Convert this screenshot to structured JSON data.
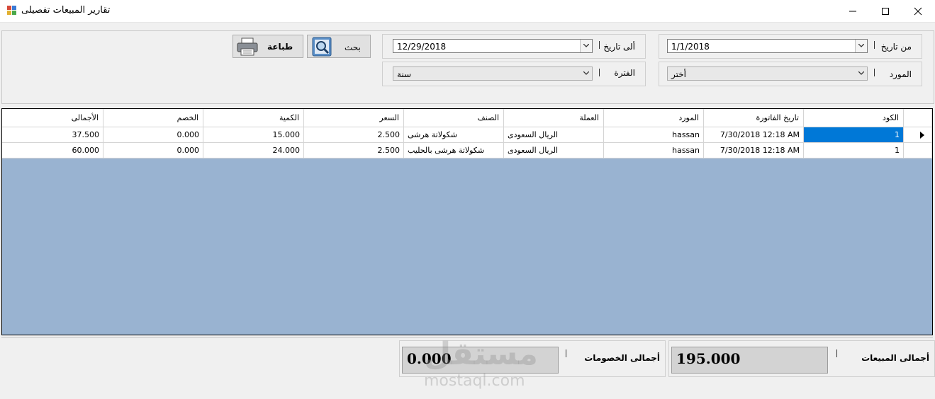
{
  "window": {
    "title": "تقارير المبيعات تفصيلى",
    "minimize_glyph": "—",
    "maximize_glyph": "☐",
    "close_glyph": "✕"
  },
  "filters": {
    "from_date_label": "من تاريخ",
    "from_date_value": "1/1/2018",
    "to_date_label": "ألى تاريخ",
    "to_date_value": "12/29/2018",
    "supplier_label": "المورد",
    "supplier_value": "أختر",
    "period_label": "الفترة",
    "period_value": "سنة"
  },
  "toolbar": {
    "search_label": "بحث",
    "print_label": "طباعة"
  },
  "grid": {
    "columns": [
      "الكود",
      "تاريخ الفاتورة",
      "المورد",
      "العملة",
      "الصنف",
      "السعر",
      "الكمية",
      "الخصم",
      "الأجمالى"
    ],
    "rows": [
      [
        "1",
        "7/30/2018 12:18 AM",
        "hassan",
        "الريال السعودى",
        "شكولاتة هرشى",
        "2.500",
        "15.000",
        "0.000",
        "37.500"
      ],
      [
        "1",
        "7/30/2018 12:18 AM",
        "hassan",
        "الريال السعودى",
        "شكولاتة هرشى بالحليب",
        "2.500",
        "24.000",
        "0.000",
        "60.000"
      ]
    ]
  },
  "totals": {
    "sales_label": "أجمالى المبيعات",
    "sales_value": "195.000",
    "discounts_label": "أجمالى الخصومات",
    "discounts_value": "0.000"
  },
  "watermark": {
    "arabic": "مستقل",
    "latin": "mostaql.com"
  },
  "colors": {
    "grid_background": "#99b3d1",
    "selection": "#0078d7"
  }
}
